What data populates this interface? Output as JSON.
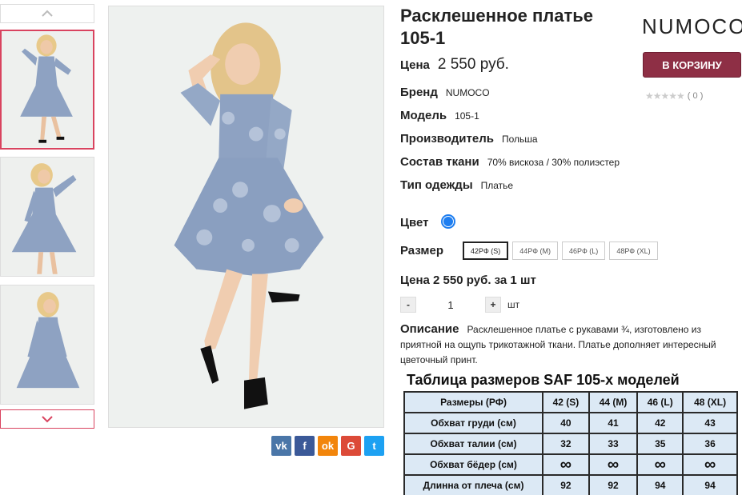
{
  "product": {
    "title": "Расклешенное платье 105-1",
    "brand_logo": "NUMOCO",
    "cart_button": "В КОРЗИНУ",
    "rating_count": "( 0 )",
    "price_label": "Цена",
    "price_value": "2 550 руб.",
    "brand_label": "Бренд",
    "brand_value": "NUMOCO",
    "model_label": "Модель",
    "model_value": "105-1",
    "maker_label": "Производитель",
    "maker_value": "Польша",
    "fabric_label": "Состав ткани",
    "fabric_value": "70% вискоза / 30% полиэстер",
    "type_label": "Тип одежды",
    "type_value": "Платье",
    "color_label": "Цвет",
    "color_hex": "#1e7ef0",
    "size_label": "Размер",
    "sizes": [
      "42РФ (S)",
      "44РФ (M)",
      "46РФ (L)",
      "48РФ (XL)"
    ],
    "selected_size": "42РФ (S)",
    "unit_price": "Цена 2 550 руб. за 1 шт",
    "quantity": "1",
    "qty_minus": "-",
    "qty_plus": "+",
    "qty_unit": "шт",
    "description_label": "Описание",
    "description_text": "Расклешенное платье с рукавами ¾, изготовлено из приятной на ощупь трикотажной ткани. Платье дополняет интересный цветочный принт."
  },
  "share": {
    "vk": "vk",
    "fb": "f",
    "ok": "ok",
    "gp": "G",
    "tw": "t"
  },
  "size_table": {
    "title": "Таблица размеров SAF 105-х моделей",
    "header": [
      "Размеры (РФ)",
      "42 (S)",
      "44 (M)",
      "46 (L)",
      "48 (XL)"
    ],
    "rows": [
      [
        "Обхват груди (см)",
        "40",
        "41",
        "42",
        "43"
      ],
      [
        "Обхват талии (см)",
        "32",
        "33",
        "35",
        "36"
      ],
      [
        "Обхват бёдер (см)",
        "∞",
        "∞",
        "∞",
        "∞"
      ],
      [
        "Длинна от плеча (см)",
        "92",
        "92",
        "94",
        "94"
      ]
    ]
  },
  "colors": {
    "accent": "#8e2f45",
    "active_thumb": "#d9435f",
    "table_bg": "#dce9f5"
  }
}
